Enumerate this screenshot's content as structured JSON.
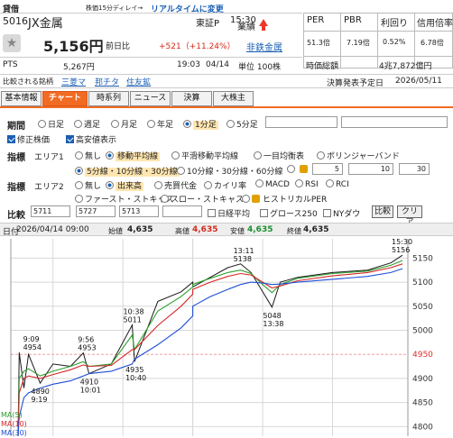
{
  "header": {
    "credit_label": "貸借",
    "delay_note": "株価15分ディレイ→",
    "realtime_link": "リアルタイムに変更",
    "code": "5016",
    "name": "JX金属",
    "market": "東証P",
    "time": "15:30",
    "category_label": "業績",
    "sector": "非鉄金属",
    "price": "5,156円",
    "prev_label": "前日比",
    "change": "+521（+11.24%）",
    "pts_label": "PTS",
    "pts_price": "5,267円",
    "pts_time": "19:03",
    "pts_date": "04/14",
    "unit": "単位 100株",
    "compare_label": "比較される銘柄",
    "compare_stocks": [
      "三菱マ",
      "邦チタ",
      "住友鉱"
    ]
  },
  "metrics": {
    "per_label": "PER",
    "per_value": "51.3倍",
    "pbr_label": "PBR",
    "pbr_value": "7.19倍",
    "yield_label": "利回り",
    "yield_value": "0.52%",
    "margin_label": "信用倍率",
    "margin_value": "6.78倍",
    "mcap_label": "時価総額",
    "mcap_value": "4兆7,872億円",
    "earnings_label": "決算発表予定日",
    "earnings_date": "2026/05/11"
  },
  "tabs": [
    "基本情報",
    "チャート",
    "時系列",
    "ニュース",
    "決算",
    "大株主"
  ],
  "controls": {
    "period_label": "期間",
    "periods": [
      "日足",
      "週足",
      "月足",
      "年足",
      "1分足",
      "5分足"
    ],
    "adjusted_label": "修正株価",
    "highlow_label": "高安値表示",
    "indicator_label": "指標",
    "area1_label": "エリア1",
    "area1_options": [
      "無し",
      "移動平均線",
      "平滑移動平均線",
      "一目均衡表",
      "ボリンジャーバンド"
    ],
    "ma_options": [
      "5分線・10分線・30分線",
      "10分線・30分線・60分線"
    ],
    "ma_custom": [
      "5",
      "10",
      "30"
    ],
    "area2_label": "エリア2",
    "area2_row1": [
      "無し",
      "出来高",
      "売買代金",
      "カイリ率",
      "MACD",
      "RSI",
      "RCI"
    ],
    "area2_row2": [
      "ファースト・ストキャス",
      "スロー・ストキャス",
      "ヒストリカルPER"
    ],
    "compare_label": "比較",
    "compare_inputs": [
      "5711",
      "5727",
      "5713",
      ""
    ],
    "nikkei_label": "日経平均",
    "growth_label": "グロース250",
    "nydow_label": "NYダウ",
    "compare_btn": "比較",
    "clear_btn": "クリア"
  },
  "chart_info": {
    "label": "日付",
    "datetime": "2026/04/14 09:00",
    "open_label": "始値",
    "open": "4,635",
    "high_label": "高値",
    "high": "4,635",
    "low_label": "安値",
    "low": "4,635",
    "close_label": "終値",
    "close": "4,635"
  },
  "chart_data": {
    "type": "line",
    "ylim": [
      4780,
      5190
    ],
    "yticks": [
      4800,
      4850,
      4900,
      4950,
      5000,
      5050,
      5100,
      5150
    ],
    "highlight_tick": 4950,
    "x": [
      "9:00",
      "9:01",
      "9:05",
      "9:09",
      "9:19",
      "9:30",
      "9:45",
      "9:56",
      "10:01",
      "10:20",
      "10:38",
      "10:40",
      "11:00",
      "11:20",
      "11:30",
      "12:30",
      "12:45",
      "13:00",
      "13:11",
      "13:20",
      "13:30",
      "13:38",
      "13:45",
      "14:00",
      "14:30",
      "15:00",
      "15:20",
      "15:30"
    ],
    "series": [
      {
        "name": "",
        "color": "#1a1a1a",
        "values": [
          4635,
          4954,
          4880,
          4950,
          4890,
          4930,
          4925,
          4953,
          4910,
          4930,
          5011,
          4935,
          5060,
          5080,
          5100,
          5090,
          5110,
          5130,
          5138,
          5120,
          5080,
          5048,
          5100,
          5110,
          5120,
          5125,
          5140,
          5156
        ]
      },
      {
        "name": "MA(5)",
        "color": "#2ca02c",
        "values": [
          4635,
          4900,
          4915,
          4920,
          4905,
          4915,
          4925,
          4935,
          4925,
          4930,
          4990,
          4960,
          5040,
          5070,
          5090,
          5095,
          5108,
          5120,
          5125,
          5118,
          5095,
          5078,
          5095,
          5108,
          5118,
          5123,
          5135,
          5145
        ]
      },
      {
        "name": "MA(10)",
        "color": "#d62728",
        "values": [
          4635,
          4870,
          4900,
          4905,
          4900,
          4908,
          4918,
          4928,
          4925,
          4927,
          4960,
          4960,
          5010,
          5050,
          5075,
          5085,
          5100,
          5112,
          5118,
          5115,
          5100,
          5088,
          5092,
          5103,
          5113,
          5120,
          5130,
          5138
        ]
      },
      {
        "name": "MA(30)",
        "color": "#1f4fd6",
        "values": [
          4635,
          4820,
          4860,
          4870,
          4880,
          4888,
          4895,
          4905,
          4910,
          4915,
          4930,
          4940,
          4970,
          5005,
          5030,
          5050,
          5070,
          5085,
          5095,
          5100,
          5098,
          5095,
          5096,
          5100,
          5106,
          5112,
          5120,
          5128
        ]
      }
    ],
    "annotations": [
      {
        "text": "9:09\n4954"
      },
      {
        "text": "9:56\n4953"
      },
      {
        "text": "10:38\n5011"
      },
      {
        "text": "13:11\n5138"
      },
      {
        "text": "15:30\n5156"
      },
      {
        "text": "4910\n10:01"
      },
      {
        "text": "4935\n10:40"
      },
      {
        "text": "4890\n9:19"
      },
      {
        "text": "5048\n13:38"
      }
    ],
    "legend": [
      "MA(5)",
      "MA(10)",
      "MA(30)"
    ]
  }
}
